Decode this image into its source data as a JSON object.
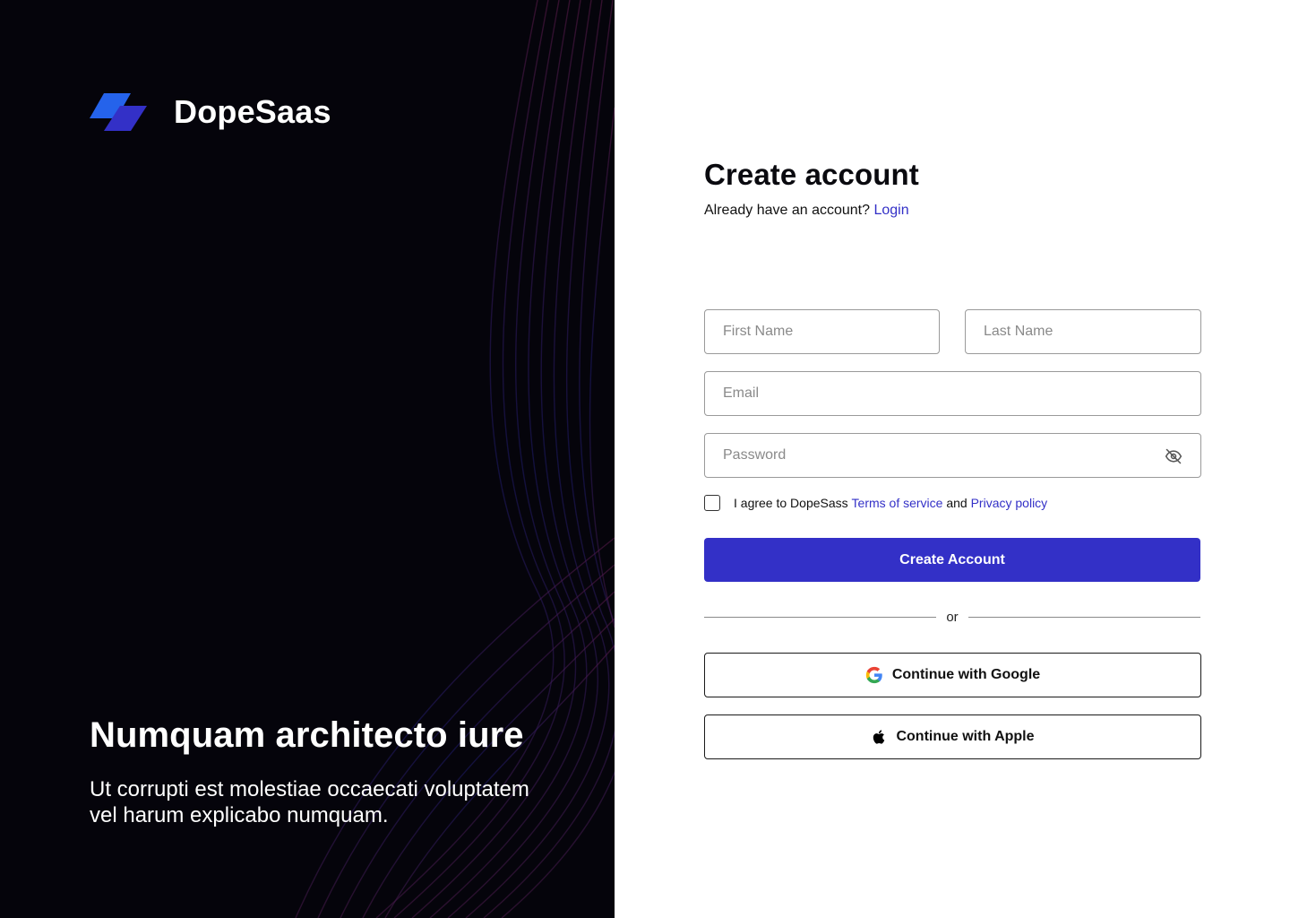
{
  "brand": {
    "name": "DopeSaas",
    "colors": {
      "primary": "#3330c7",
      "mark_light": "#2563eb",
      "mark_dark": "#3330c7",
      "panel_bg": "#05040b"
    }
  },
  "hero": {
    "title": "Numquam architecto iure",
    "subtitle": "Ut corrupti est molestiae occaecati voluptatem vel harum explicabo numquam."
  },
  "form": {
    "title": "Create account",
    "subtitle_text": "Already have an account?",
    "login_link": "Login",
    "first_name_placeholder": "First Name",
    "last_name_placeholder": "Last Name",
    "email_placeholder": "Email",
    "password_placeholder": "Password",
    "password_toggle_icon": "eye-off-icon",
    "agree_prefix": "I agree to DopeSass",
    "terms_link": "Terms of service",
    "agree_and": "and",
    "privacy_link": "Privacy policy",
    "agree_checked": false,
    "submit_label": "Create Account",
    "divider_text": "or",
    "google_label": "Continue with Google",
    "google_icon": "google-icon",
    "apple_label": "Continue with Apple",
    "apple_icon": "apple-icon"
  }
}
